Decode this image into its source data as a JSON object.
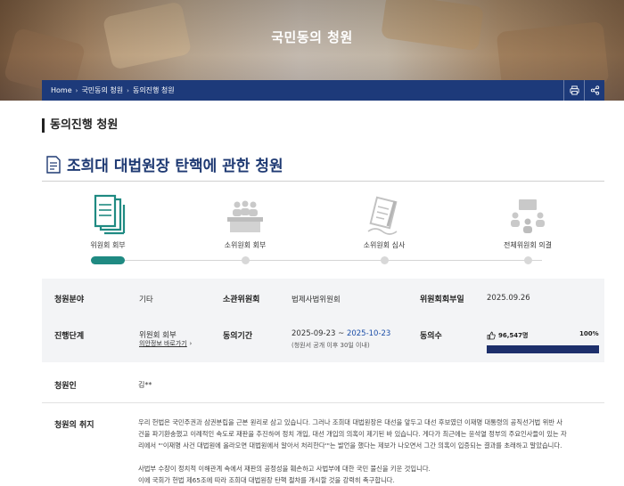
{
  "hero": {
    "title": "국민동의 청원"
  },
  "breadcrumb": {
    "items": [
      "Home",
      "국민동의 청원",
      "동의진행 청원"
    ]
  },
  "tools": {
    "print_icon": "print-icon",
    "share_icon": "share-icon"
  },
  "section": {
    "title": "동의진행 청원"
  },
  "petition": {
    "title": "조희대 대법원장 탄핵에 관한 청원"
  },
  "steps": [
    {
      "label": "위원회 회부",
      "icon": "documents-icon",
      "active": true
    },
    {
      "label": "소위원회 회부",
      "icon": "meeting-icon",
      "active": false
    },
    {
      "label": "소위원회 심사",
      "icon": "review-icon",
      "active": false
    },
    {
      "label": "전체위원회 의결",
      "icon": "committee-icon",
      "active": false
    }
  ],
  "info": {
    "field_label": "청원분야",
    "field_value": "기타",
    "committee_label": "소관위원회",
    "committee_value": "법제사법위원회",
    "referral_date_label": "위원회회부일",
    "referral_date_value": "2025.09.26",
    "stage_label": "진행단계",
    "stage_value": "위원회 회부",
    "stage_link": "의안정보 바로가기",
    "period_label": "동의기간",
    "period_start": "2025-09-23",
    "period_tilde": " ~ ",
    "period_end": "2025-10-23",
    "period_note": "(청원서 공개 이후 30일 이내)",
    "votes_label": "동의수",
    "votes_value": "96,547명",
    "votes_percent_text": "100%",
    "votes_percent": 100
  },
  "petitioner": {
    "label": "청원인",
    "value": "김**"
  },
  "purpose": {
    "label": "청원의 취지",
    "lines": [
      "우리 헌법은 국민주권과 삼권분립을 근본 원리로 삼고 있습니다. 그러나 조희대 대법원장은 대선을 앞두고 대선 후보였던 이재명 대통령의 공직선거법 위반 사",
      "건을 파기환송했고 이례적인 속도로 재판을 추진하여 정치 개입, 대선 개입의 의혹이 제기된 바 있습니다. 게다가 최근에는 윤석열 정부의 주요인사들이 있는 자",
      "리에서 \"'이재명 사건 대법원에 올라오면 대법원에서 알아서 처리한다'\"는 발언을 했다는 제보가 나오면서 그간 의혹이 입증되는 결과를 초래하고 말았습니다.",
      "",
      "사법부 수장이 정치적 이해관계 속에서 재판의 공정성을 훼손하고 사법부에 대한 국민 불신을 키운 것입니다.",
      "이에 국회가 헌법 제65조에 따라 조희대 대법원장 탄핵 절차를 개시할 것을 강력히 촉구합니다."
    ]
  },
  "colors": {
    "accent_teal": "#1f8a82",
    "navy": "#1d3a7a",
    "title_blue": "#1f3a73",
    "date_blue": "#1d4fa8"
  }
}
